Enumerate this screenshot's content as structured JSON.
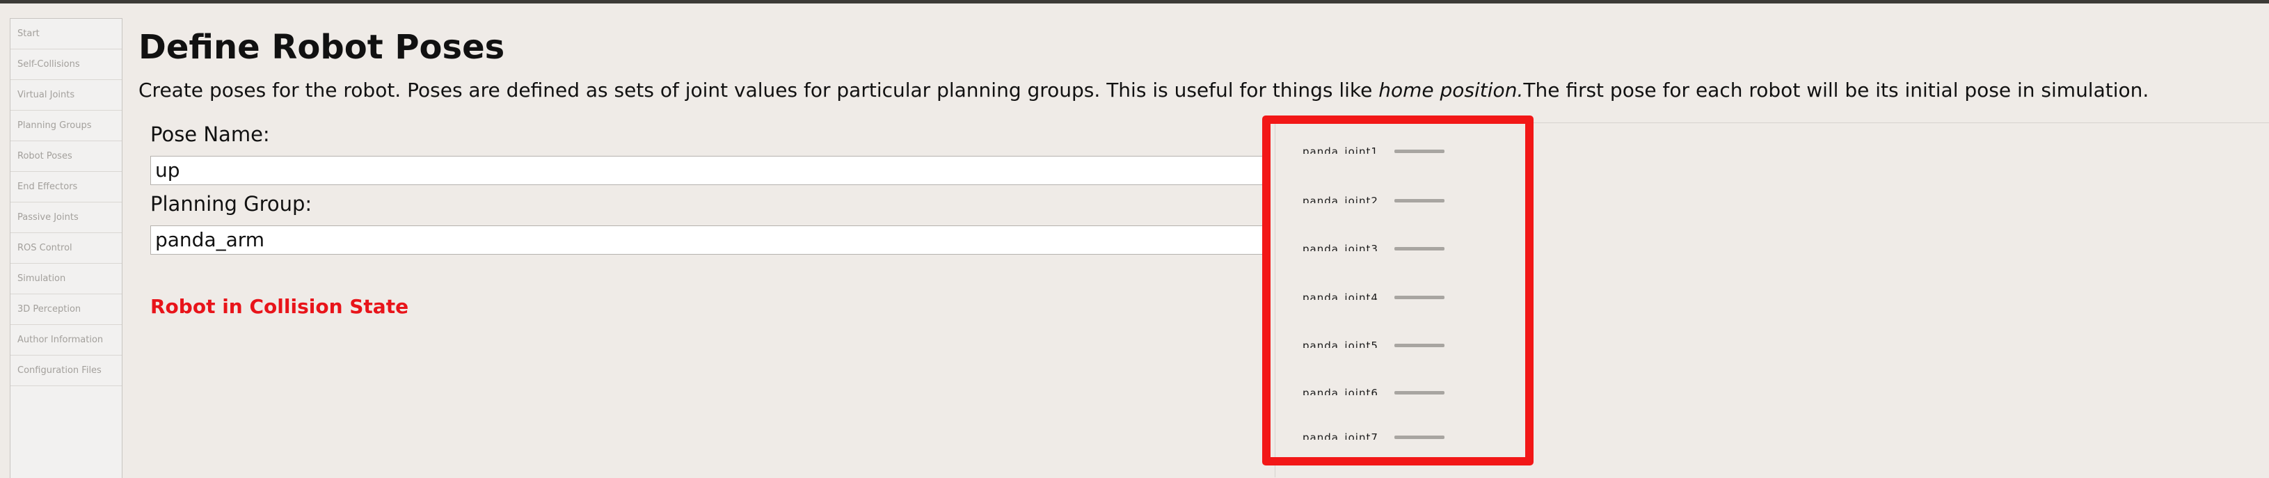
{
  "sidebar": {
    "items": [
      {
        "label": "Start"
      },
      {
        "label": "Self-Collisions"
      },
      {
        "label": "Virtual Joints"
      },
      {
        "label": "Planning Groups"
      },
      {
        "label": "Robot Poses"
      },
      {
        "label": "End Effectors"
      },
      {
        "label": "Passive Joints"
      },
      {
        "label": "ROS Control"
      },
      {
        "label": "Simulation"
      },
      {
        "label": "3D Perception"
      },
      {
        "label": "Author Information"
      },
      {
        "label": "Configuration Files"
      }
    ]
  },
  "header": {
    "title": "Define Robot Poses",
    "description_part1": "Create poses for the robot. Poses are defined as sets of joint values for particular planning groups. This is useful for things like ",
    "description_emphasis": "home position.",
    "description_part2": "The first pose for each robot will be its initial pose in simulation."
  },
  "form": {
    "pose_name_label": "Pose Name:",
    "pose_name_value": "up",
    "planning_group_label": "Planning Group:",
    "planning_group_value": "panda_arm"
  },
  "status": {
    "collision_text": "Robot in Collision State",
    "collision_color": "#e8141a"
  },
  "joints": {
    "items": [
      {
        "label": "panda_joint1"
      },
      {
        "label": "panda_joint2"
      },
      {
        "label": "panda_joint3"
      },
      {
        "label": "panda_joint4"
      },
      {
        "label": "panda_joint5"
      },
      {
        "label": "panda_joint6"
      },
      {
        "label": "panda_joint7"
      }
    ]
  },
  "colors": {
    "highlight_border": "#f21717",
    "background": "#efebe7"
  }
}
